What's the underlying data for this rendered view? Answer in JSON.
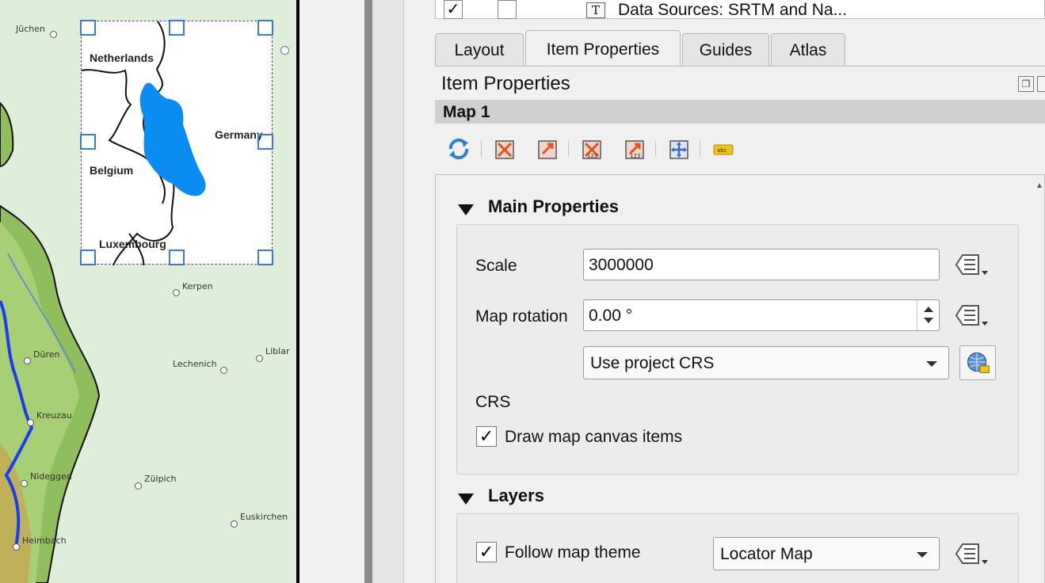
{
  "map_canvas": {
    "places": [
      "Jüchen",
      "Kerpen",
      "Düren",
      "Lechenich",
      "Liblar",
      "Kreuzau",
      "Nideggen",
      "Zülpich",
      "Euskirchen",
      "Heimbach"
    ],
    "locator": {
      "labels": [
        "Netherlands",
        "Germany",
        "Belgium",
        "Luxembourg"
      ]
    },
    "colors": {
      "lowland": "#dfeedb",
      "upland": "#8fbf5d",
      "river": "#1a3ef0",
      "locator_area": "#0a8cf0",
      "selection": "#3a7bd5"
    }
  },
  "layers_tree": {
    "row_checked": "✓",
    "row_text": "Data Sources: SRTM and Na...",
    "type_icon": "text-layer-icon"
  },
  "tabs": [
    {
      "label": "Layout"
    },
    {
      "label": "Item Properties",
      "active": true
    },
    {
      "label": "Guides"
    },
    {
      "label": "Atlas"
    }
  ],
  "panel": {
    "title": "Item Properties",
    "item_name": "Map 1"
  },
  "toolbar_icons": [
    "refresh-icon",
    "set-extent-to-canvas-icon",
    "view-extent-in-canvas-icon",
    "set-scale-to-canvas-icon",
    "view-scale-in-canvas-icon",
    "move-item-content-icon",
    "label-blocking-icon"
  ],
  "main_properties": {
    "title": "Main Properties",
    "scale_label": "Scale",
    "scale_value": "3000000",
    "rotation_label": "Map rotation",
    "rotation_value": "0.00 °",
    "crs_value": "Use project CRS",
    "crs_label": "CRS",
    "draw_items_checked": "✓",
    "draw_items_label": "Draw map canvas items"
  },
  "layers": {
    "title": "Layers",
    "follow_theme_checked": "✓",
    "follow_theme_label": "Follow map theme",
    "theme_value": "Locator Map"
  }
}
